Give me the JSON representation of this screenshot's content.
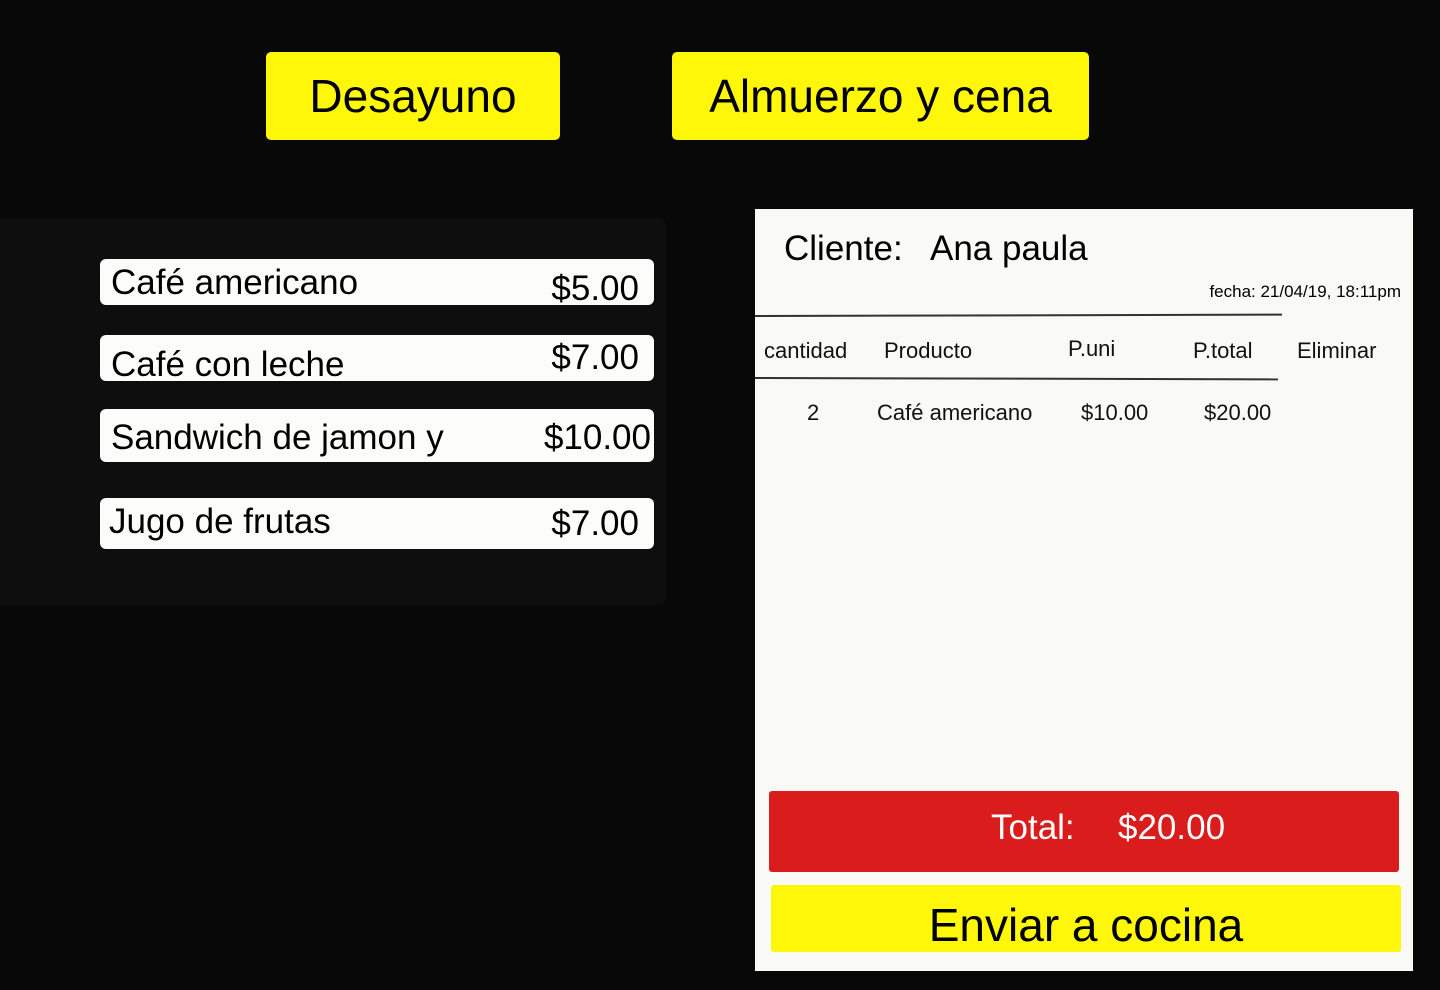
{
  "tabs": {
    "breakfast": "Desayuno",
    "lunch_dinner": "Almuerzo y cena"
  },
  "menu": {
    "items": [
      {
        "name": "Café americano",
        "price": "$5.00"
      },
      {
        "name": "Café con leche",
        "price": "$7.00"
      },
      {
        "name": "Sandwich de jamon y",
        "price": "$10.00"
      },
      {
        "name": "Jugo de frutas",
        "price": "$7.00"
      }
    ]
  },
  "order": {
    "client_label": "Cliente:",
    "client_name": "Ana paula",
    "date": "fecha: 21/04/19, 18:11pm",
    "columns": {
      "quantity": "cantidad",
      "product": "Producto",
      "unit_price": "P.uni",
      "total_price": "P.total",
      "delete": "Eliminar"
    },
    "rows": [
      {
        "quantity": "2",
        "product": "Café americano",
        "unit_price": "$10.00",
        "total_price": "$20.00"
      }
    ],
    "total_label": "Total:",
    "total_value": "$20.00",
    "send_label": "Enviar a cocina"
  },
  "colors": {
    "background": "#080808",
    "accent_yellow": "#fff70a",
    "total_red": "#da1c1c",
    "panel": "#f9f9f6"
  }
}
